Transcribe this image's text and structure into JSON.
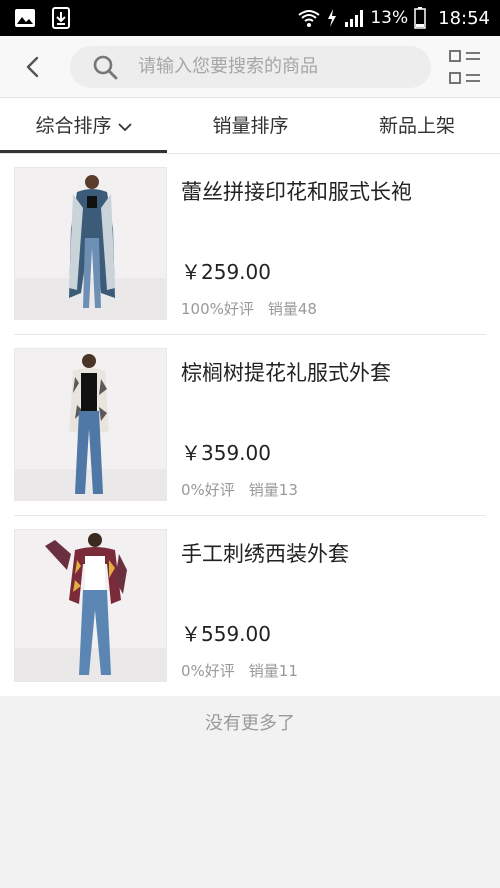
{
  "status_bar": {
    "battery": "13%",
    "time": "18:54",
    "left_icons": [
      "image-icon",
      "download-icon"
    ],
    "right_icons": [
      "wifi-icon",
      "charging-icon",
      "signal-icon",
      "battery-icon"
    ]
  },
  "header": {
    "search_placeholder": "请输入您要搜索的商品"
  },
  "tabs": [
    {
      "label": "综合排序",
      "active": true
    },
    {
      "label": "销量排序",
      "active": false
    },
    {
      "label": "新品上架",
      "active": false
    }
  ],
  "products": [
    {
      "title": "蕾丝拼接印花和服式长袍",
      "price": "￥259.00",
      "rating": "100%好评",
      "sales": "销量48"
    },
    {
      "title": "棕榈树提花礼服式外套",
      "price": "￥359.00",
      "rating": "0%好评",
      "sales": "销量13"
    },
    {
      "title": "手工刺绣西装外套",
      "price": "￥559.00",
      "rating": "0%好评",
      "sales": "销量11"
    }
  ],
  "footer_note": "没有更多了",
  "colors": {
    "active_tab_underline": "#333333",
    "page_bg": "#f2f2f2"
  }
}
